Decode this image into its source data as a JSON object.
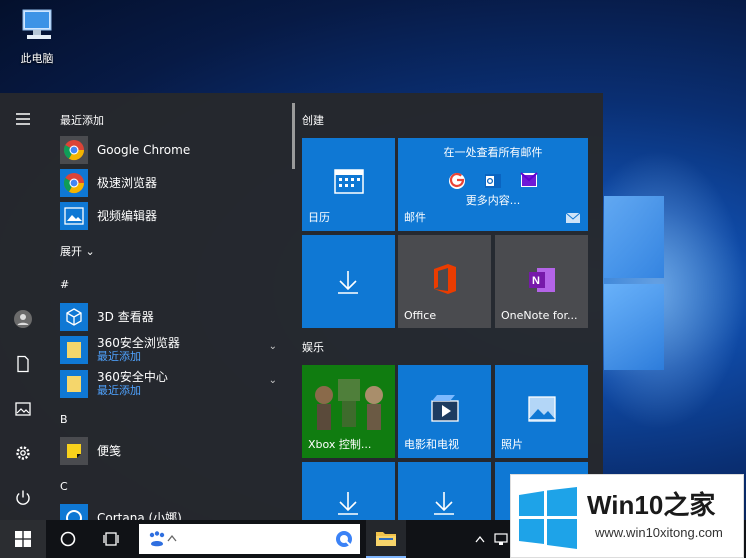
{
  "desktop": {
    "this_pc_label": "此电脑"
  },
  "start_menu": {
    "recently_added_header": "最近添加",
    "expand_label": "展开",
    "apps": [
      {
        "name": "Google Chrome",
        "icon": "chrome-icon"
      },
      {
        "name": "极速浏览器",
        "icon": "browser-icon"
      },
      {
        "name": "视频编辑器",
        "icon": "video-editor-icon"
      }
    ],
    "section_hash": "#",
    "apps_hash": [
      {
        "name": "3D 查看器",
        "icon": "cube-icon"
      },
      {
        "name": "360安全浏览器",
        "sub": "最近添加",
        "icon": "folder-icon"
      },
      {
        "name": "360安全中心",
        "sub": "最近添加",
        "icon": "folder-icon"
      }
    ],
    "section_b": "B",
    "apps_b": [
      {
        "name": "便笺",
        "icon": "sticky-notes-icon"
      }
    ],
    "section_c": "C",
    "apps_c": [
      {
        "name": "Cortana (小娜)",
        "icon": "cortana-icon"
      }
    ]
  },
  "tiles": {
    "group_create": "创建",
    "group_entertainment": "娱乐",
    "calendar_label": "日历",
    "mail_header": "在一处查看所有邮件",
    "mail_more": "更多内容...",
    "mail_label": "邮件",
    "office_label": "Office",
    "onenote_label": "OneNote for...",
    "xbox_label": "Xbox 控制...",
    "movies_label": "电影和电视",
    "photos_label": "照片"
  },
  "watermark": {
    "title": "Win10之家",
    "url": "www.win10xitong.com"
  },
  "colors": {
    "tile_blue": "#0f78d4",
    "menu_bg": "#26282c",
    "taskbar": "#101216",
    "link_blue": "#4fa3ff"
  }
}
